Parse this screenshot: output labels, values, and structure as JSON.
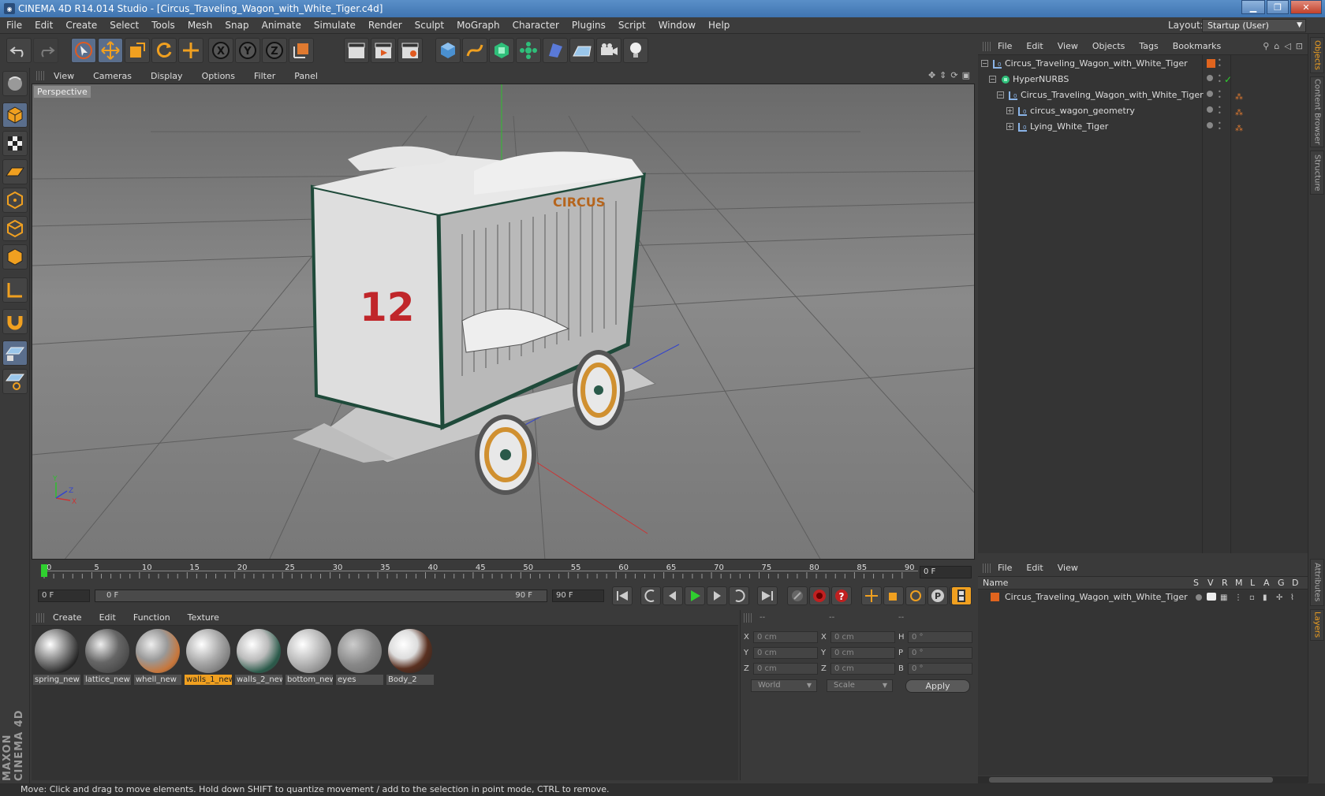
{
  "window": {
    "title": "CINEMA 4D R14.014 Studio - [Circus_Traveling_Wagon_with_White_Tiger.c4d]",
    "app_icon": "c4d-logo-icon",
    "minimize": "▁",
    "maximize": "❐",
    "close": "✕"
  },
  "menubar": {
    "items": [
      "File",
      "Edit",
      "Create",
      "Select",
      "Tools",
      "Mesh",
      "Snap",
      "Animate",
      "Simulate",
      "Render",
      "Sculpt",
      "MoGraph",
      "Character",
      "Plugins",
      "Script",
      "Window",
      "Help"
    ],
    "layout_label": "Layout:",
    "layout_value": "Startup (User)"
  },
  "viewport": {
    "menu": [
      "View",
      "Cameras",
      "Display",
      "Options",
      "Filter",
      "Panel"
    ],
    "label": "Perspective",
    "axis": {
      "x": "X",
      "y": "Y",
      "z": "Z"
    },
    "wagon_text": "CIRCUS",
    "wagon_number": "12"
  },
  "timeline": {
    "ticks": [
      "0",
      "5",
      "10",
      "15",
      "20",
      "25",
      "30",
      "35",
      "40",
      "45",
      "50",
      "55",
      "60",
      "65",
      "70",
      "75",
      "80",
      "85",
      "90"
    ],
    "current_frame": "0 F"
  },
  "transport": {
    "start_field": "0 F",
    "range_start": "0 F",
    "range_end": "90 F",
    "end_field": "90 F"
  },
  "materials": {
    "menu": [
      "Create",
      "Edit",
      "Function",
      "Texture"
    ],
    "items": [
      {
        "name": "spring_new",
        "selected": false
      },
      {
        "name": "lattice_new",
        "selected": false
      },
      {
        "name": "whell_new",
        "selected": false
      },
      {
        "name": "walls_1_new",
        "selected": true
      },
      {
        "name": "walls_2_new",
        "selected": false
      },
      {
        "name": "bottom_new",
        "selected": false
      },
      {
        "name": "eyes",
        "selected": false
      },
      {
        "name": "Body_2",
        "selected": false
      }
    ]
  },
  "coords": {
    "col_headers": [
      "--",
      "--",
      "--"
    ],
    "rows": [
      {
        "a": "X",
        "av": "0 cm",
        "b": "X",
        "bv": "0 cm",
        "c": "H",
        "cv": "0 °"
      },
      {
        "a": "Y",
        "av": "0 cm",
        "b": "Y",
        "bv": "0 cm",
        "c": "P",
        "cv": "0 °"
      },
      {
        "a": "Z",
        "av": "0 cm",
        "b": "Z",
        "bv": "0 cm",
        "c": "B",
        "cv": "0 °"
      }
    ],
    "mode": "World",
    "scale": "Scale",
    "apply": "Apply"
  },
  "status": "Move: Click and drag to move elements. Hold down SHIFT to quantize movement / add to the selection in point mode, CTRL to remove.",
  "objects": {
    "menu": [
      "File",
      "Edit",
      "View",
      "Objects",
      "Tags",
      "Bookmarks"
    ],
    "rows": [
      {
        "name": "Circus_Traveling_Wagon_with_White_Tiger",
        "expander": "−"
      },
      {
        "name": "HyperNURBS",
        "expander": "−"
      },
      {
        "name": "Circus_Traveling_Wagon_with_White_Tiger",
        "expander": "−"
      },
      {
        "name": "circus_wagon_geometry",
        "expander": "+"
      },
      {
        "name": "Lying_White_Tiger",
        "expander": "+"
      }
    ],
    "checkmark": "✓"
  },
  "side_tabs": [
    "Objects",
    "Content Browser",
    "Structure",
    "Attributes",
    "Layers"
  ],
  "layers": {
    "menu": [
      "File",
      "Edit",
      "View"
    ],
    "columns": [
      "Name",
      "S",
      "V",
      "R",
      "M",
      "L",
      "A",
      "G",
      "D"
    ],
    "rows": [
      {
        "name": "Circus_Traveling_Wagon_with_White_Tiger"
      }
    ]
  },
  "brand": "MAXON CINEMA 4D",
  "colors": {
    "accent": "#f0a020",
    "layer_orange": "#e0641e",
    "selection_blue": "#5a6e8c"
  }
}
